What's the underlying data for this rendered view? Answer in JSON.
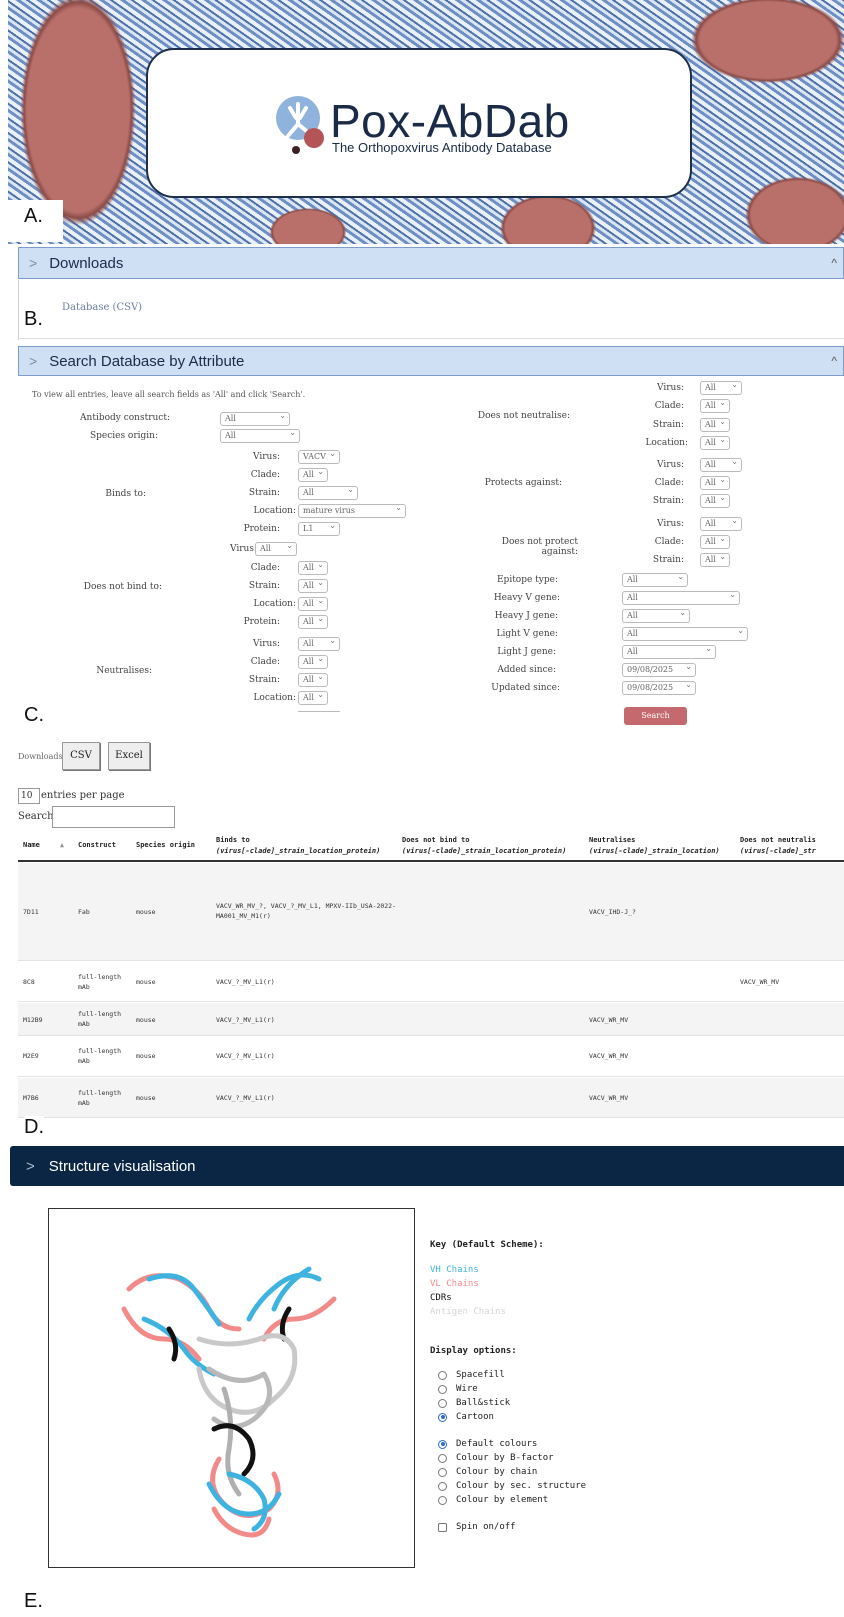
{
  "panel_letters": {
    "a": "A.",
    "b": "B.",
    "c": "C.",
    "d": "D.",
    "e": "E."
  },
  "banner": {
    "title": "Pox-AbDab",
    "subtitle": "The Orthopoxvirus Antibody Database"
  },
  "downloads_section": {
    "title": "Downloads",
    "link": "Database (CSV)"
  },
  "search_section": {
    "title": "Search Database by Attribute",
    "instructions": "To view all entries, leave all search fields as 'All' and click 'Search'.",
    "search_button": "Search",
    "labels": {
      "antibody_construct": "Antibody construct:",
      "species_origin": "Species origin:",
      "binds_to": "Binds to:",
      "does_not_bind_to": "Does not bind to:",
      "neutralises": "Neutralises:",
      "does_not_neutralise": "Does not neutralise:",
      "protects_against": "Protects against:",
      "does_not_protect_against": "Does not protect against:",
      "epitope_type": "Epitope type:",
      "heavy_v": "Heavy V gene:",
      "heavy_j": "Heavy J gene:",
      "light_v": "Light V gene:",
      "light_j": "Light J gene:",
      "added_since": "Added since:",
      "updated_since": "Updated since:",
      "virus": "Virus:",
      "clade": "Clade:",
      "strain": "Strain:",
      "location": "Location:",
      "protein": "Protein:"
    },
    "values": {
      "all": "All",
      "vacv": "VACV",
      "mature_virus": "mature virus",
      "l1": "L1",
      "date": "09/08/2025"
    }
  },
  "results": {
    "downloads_label": "Downloads:",
    "csv": "CSV",
    "excel": "Excel",
    "page_size": "10",
    "entries_per_page": "entries per page",
    "search_label": "Search:",
    "columns": [
      {
        "name": "Name",
        "sub": ""
      },
      {
        "name": "Construct",
        "sub": ""
      },
      {
        "name": "Species origin",
        "sub": ""
      },
      {
        "name": "Binds to",
        "sub": "(virus[-clade]_strain_location_protein)"
      },
      {
        "name": "Does not bind to",
        "sub": "(virus[-clade]_strain_location_protein)"
      },
      {
        "name": "Neutralises",
        "sub": "(virus[-clade]_strain_location)"
      },
      {
        "name": "Does not neutralis",
        "sub": "(virus[-clade]_str"
      }
    ],
    "rows": [
      {
        "name": "7D11",
        "construct": "Fab",
        "species": "mouse",
        "binds": "VACV_WR_MV_?, VACV_?_MV_L1, MPXV-IIb_USA-2022-MA001_MV_M1(r)",
        "no_bind": "",
        "neut": "VACV_IHD-J_?",
        "no_neut": ""
      },
      {
        "name": "8C8",
        "construct": "full-length mAb",
        "species": "mouse",
        "binds": "VACV_?_MV_L1(r)",
        "no_bind": "",
        "neut": "",
        "no_neut": "VACV_WR_MV"
      },
      {
        "name": "M12B9",
        "construct": "full-length mAb",
        "species": "mouse",
        "binds": "VACV_?_MV_L1(r)",
        "no_bind": "",
        "neut": "VACV_WR_MV",
        "no_neut": ""
      },
      {
        "name": "M2E9",
        "construct": "full-length mAb",
        "species": "mouse",
        "binds": "VACV_?_MV_L1(r)",
        "no_bind": "",
        "neut": "VACV_WR_MV",
        "no_neut": ""
      },
      {
        "name": "M7B6",
        "construct": "full-length mAb",
        "species": "mouse",
        "binds": "VACV_?_MV_L1(r)",
        "no_bind": "",
        "neut": "VACV_WR_MV",
        "no_neut": ""
      }
    ]
  },
  "structure": {
    "title": "Structure visualisation",
    "key_title": "Key (Default Scheme):",
    "key": [
      {
        "label": "VH Chains",
        "color": "#3fb3e0"
      },
      {
        "label": "VL Chains",
        "color": "#f28a8a"
      },
      {
        "label": "CDRs",
        "color": "#111111"
      },
      {
        "label": "Antigen Chains",
        "color": "#d6d6d6"
      }
    ],
    "display_title": "Display options:",
    "display_options": [
      "Spacefill",
      "Wire",
      "Ball&stick",
      "Cartoon"
    ],
    "colour_options": [
      "Default colours",
      "Colour by B-factor",
      "Colour by chain",
      "Colour by sec. structure",
      "Colour by element"
    ],
    "spin": "Spin on/off"
  }
}
